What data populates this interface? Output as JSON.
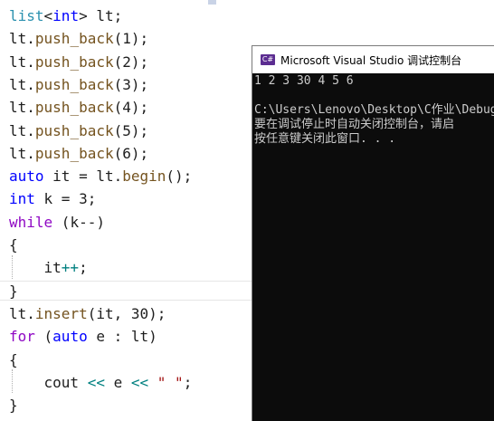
{
  "code": {
    "lines": [
      {
        "segs": [
          {
            "t": "list",
            "c": "#2b91af"
          },
          {
            "t": "<",
            "c": "#1e1e1e"
          },
          {
            "t": "int",
            "c": "#0000ff"
          },
          {
            "t": "> lt;",
            "c": "#1e1e1e"
          }
        ]
      },
      {
        "segs": [
          {
            "t": "lt.",
            "c": "#1e1e1e"
          },
          {
            "t": "push_back",
            "c": "#74531f"
          },
          {
            "t": "(1);",
            "c": "#1e1e1e"
          }
        ]
      },
      {
        "segs": [
          {
            "t": "lt.",
            "c": "#1e1e1e"
          },
          {
            "t": "push_back",
            "c": "#74531f"
          },
          {
            "t": "(2);",
            "c": "#1e1e1e"
          }
        ]
      },
      {
        "segs": [
          {
            "t": "lt.",
            "c": "#1e1e1e"
          },
          {
            "t": "push_back",
            "c": "#74531f"
          },
          {
            "t": "(3);",
            "c": "#1e1e1e"
          }
        ]
      },
      {
        "segs": [
          {
            "t": "lt.",
            "c": "#1e1e1e"
          },
          {
            "t": "push_back",
            "c": "#74531f"
          },
          {
            "t": "(4);",
            "c": "#1e1e1e"
          }
        ]
      },
      {
        "segs": [
          {
            "t": "lt.",
            "c": "#1e1e1e"
          },
          {
            "t": "push_back",
            "c": "#74531f"
          },
          {
            "t": "(5);",
            "c": "#1e1e1e"
          }
        ]
      },
      {
        "segs": [
          {
            "t": "lt.",
            "c": "#1e1e1e"
          },
          {
            "t": "push_back",
            "c": "#74531f"
          },
          {
            "t": "(6);",
            "c": "#1e1e1e"
          }
        ]
      },
      {
        "segs": [
          {
            "t": "auto",
            "c": "#0000ff"
          },
          {
            "t": " it = lt.",
            "c": "#1e1e1e"
          },
          {
            "t": "begin",
            "c": "#74531f"
          },
          {
            "t": "();",
            "c": "#1e1e1e"
          }
        ]
      },
      {
        "segs": [
          {
            "t": "int",
            "c": "#0000ff"
          },
          {
            "t": " k = 3;",
            "c": "#1e1e1e"
          }
        ]
      },
      {
        "segs": [
          {
            "t": "while",
            "c": "#8f08c4"
          },
          {
            "t": " (k--)",
            "c": "#1e1e1e"
          }
        ]
      },
      {
        "segs": [
          {
            "t": "{",
            "c": "#1e1e1e"
          }
        ]
      },
      {
        "segs": [
          {
            "t": "    it",
            "c": "#1e1e1e"
          },
          {
            "t": "++",
            "c": "#008080"
          },
          {
            "t": ";",
            "c": "#1e1e1e"
          }
        ]
      },
      {
        "segs": [
          {
            "t": "}",
            "c": "#1e1e1e"
          }
        ]
      },
      {
        "segs": [
          {
            "t": "lt.",
            "c": "#1e1e1e"
          },
          {
            "t": "insert",
            "c": "#74531f"
          },
          {
            "t": "(it, 30);",
            "c": "#1e1e1e"
          }
        ]
      },
      {
        "segs": [
          {
            "t": "for",
            "c": "#8f08c4"
          },
          {
            "t": " (",
            "c": "#1e1e1e"
          },
          {
            "t": "auto",
            "c": "#0000ff"
          },
          {
            "t": " e : lt)",
            "c": "#1e1e1e"
          }
        ]
      },
      {
        "segs": [
          {
            "t": "{",
            "c": "#1e1e1e"
          }
        ]
      },
      {
        "segs": [
          {
            "t": "    cout ",
            "c": "#1e1e1e"
          },
          {
            "t": "<<",
            "c": "#008080"
          },
          {
            "t": " e ",
            "c": "#1e1e1e"
          },
          {
            "t": "<<",
            "c": "#008080"
          },
          {
            "t": " ",
            "c": "#1e1e1e"
          },
          {
            "t": "\" \"",
            "c": "#a31515"
          },
          {
            "t": ";",
            "c": "#1e1e1e"
          }
        ]
      },
      {
        "segs": [
          {
            "t": "}",
            "c": "#1e1e1e"
          }
        ]
      }
    ]
  },
  "console": {
    "title": "Microsoft Visual Studio 调试控制台",
    "icon_label": "C#",
    "lines": [
      "1 2 3 30 4 5 6",
      "",
      "C:\\Users\\Lenovo\\Desktop\\C作业\\Debug",
      "要在调试停止时自动关闭控制台，请启",
      "按任意键关闭此窗口. . ."
    ]
  }
}
